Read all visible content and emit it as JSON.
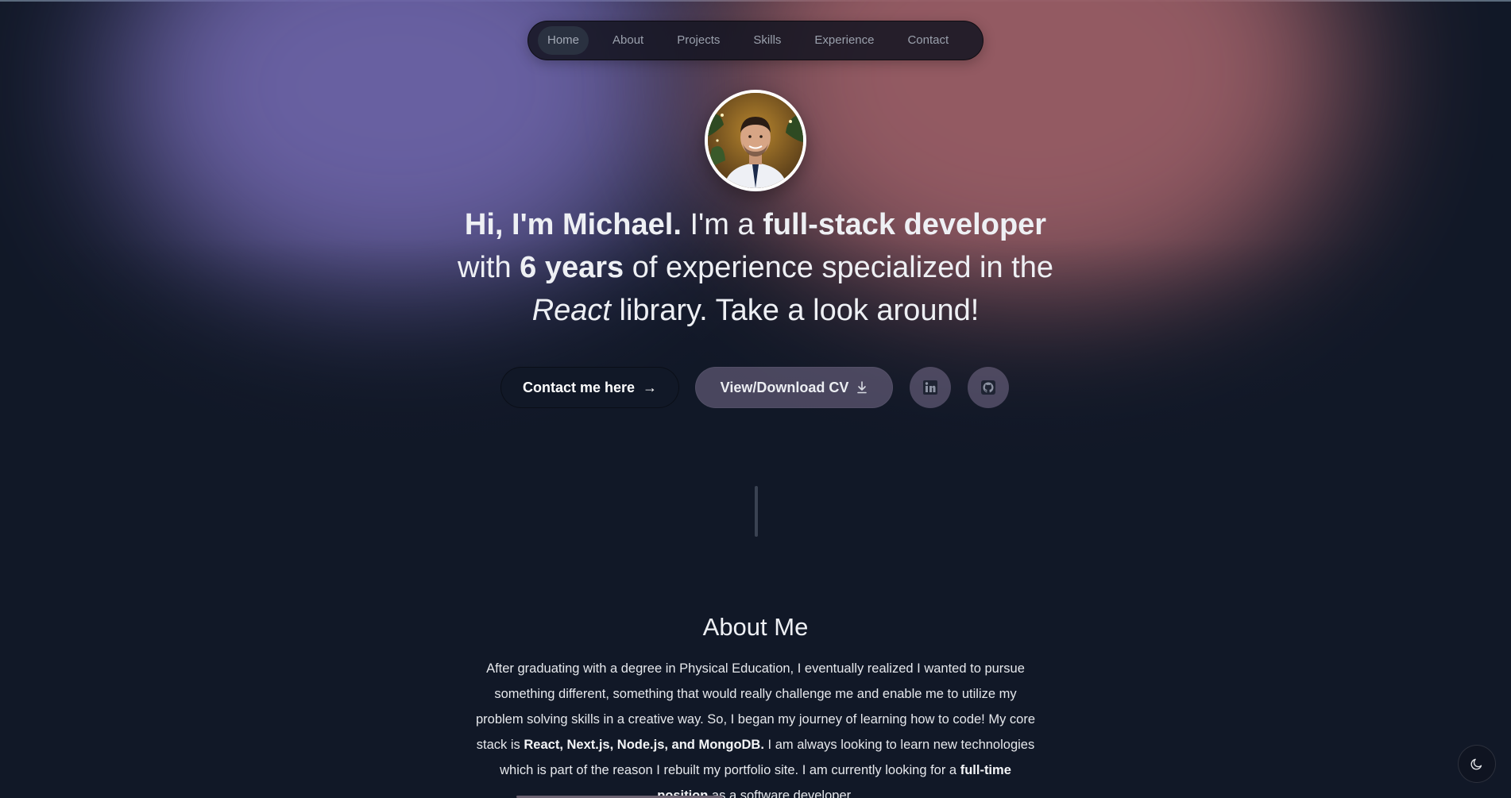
{
  "nav": {
    "items": [
      {
        "label": "Home",
        "active": true
      },
      {
        "label": "About",
        "active": false
      },
      {
        "label": "Projects",
        "active": false
      },
      {
        "label": "Skills",
        "active": false
      },
      {
        "label": "Experience",
        "active": false
      },
      {
        "label": "Contact",
        "active": false
      }
    ]
  },
  "hero": {
    "greeting": "Hi, I'm Michael.",
    "text_1": " I'm a ",
    "role": "full-stack developer",
    "text_2": "with ",
    "years": "6 years",
    "text_3": " of experience specialized in the ",
    "library": "React",
    "text_4": " library. Take a look around!"
  },
  "buttons": {
    "contact_label": "Contact me here",
    "contact_icon": "arrow-right-icon",
    "cv_label": "View/Download CV",
    "cv_icon": "download-icon",
    "linkedin_icon": "linkedin-icon",
    "github_icon": "github-icon"
  },
  "about": {
    "title": "About Me",
    "text_1": "After graduating with a degree in Physical Education, I eventually realized I wanted to pursue something different, something that would really challenge me and enable me to utilize my problem solving skills in a creative way. So, I began my journey of learning how to code! My core stack is ",
    "stack": "React, Next.js, Node.js, and MongoDB.",
    "text_2": " I am always looking to learn new technologies which is part of the reason I rebuilt my portfolio site. I am currently looking for a ",
    "position": "full-time position",
    "text_3": " as a software developer."
  },
  "theme_toggle": {
    "icon": "moon-icon"
  },
  "colors": {
    "background": "#111827",
    "button_dark": "#111827",
    "blob_purple": "#6d64a8",
    "blob_rose": "#9a5e66"
  }
}
